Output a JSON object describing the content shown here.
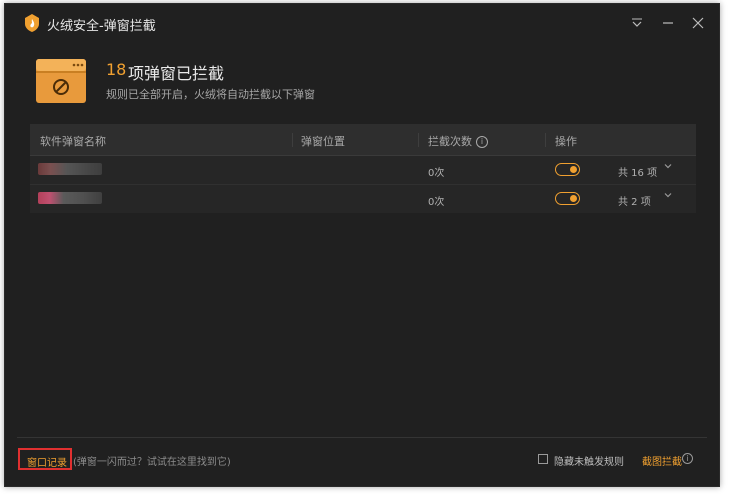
{
  "window": {
    "title": "火绒安全-弹窗拦截",
    "controls": {
      "menu_icon": "dropdown-menu-icon",
      "minimize_icon": "minimize-icon",
      "close_icon": "close-icon"
    }
  },
  "header": {
    "count": "18",
    "title": "项弹窗已拦截",
    "subtitle": "规则已全部开启，火绒将自动拦截以下弹窗",
    "icon": "blocked-window-icon"
  },
  "table": {
    "columns": [
      "软件弹窗名称",
      "弹窗位置",
      "拦截次数",
      "操作"
    ],
    "rows": [
      {
        "count": "0次",
        "enabled": true,
        "total": "共 16 项"
      },
      {
        "count": "0次",
        "enabled": true,
        "total": "共 2 项"
      }
    ]
  },
  "footer": {
    "record_label": "窗口记录",
    "record_hint": "(弹窗一闪而过？试试在这里找到它)",
    "hide_label": "隐藏未触发规则",
    "screenshot_label": "截图拦截"
  },
  "colors": {
    "accent": "#f0a030",
    "background": "#202020",
    "highlight": "#e03030"
  }
}
